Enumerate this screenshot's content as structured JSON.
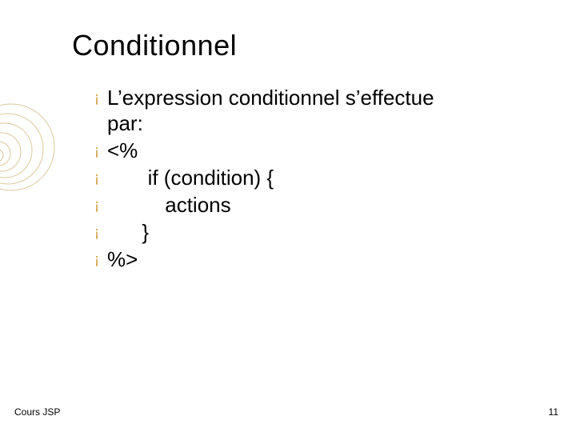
{
  "title": "Conditionnel",
  "bullets": [
    "L’expression conditionnel s’effectue\npar:",
    "<%",
    "       if (condition) {",
    "          actions",
    "      }",
    "%>"
  ],
  "footer_left": "Cours JSP",
  "footer_right": "11"
}
